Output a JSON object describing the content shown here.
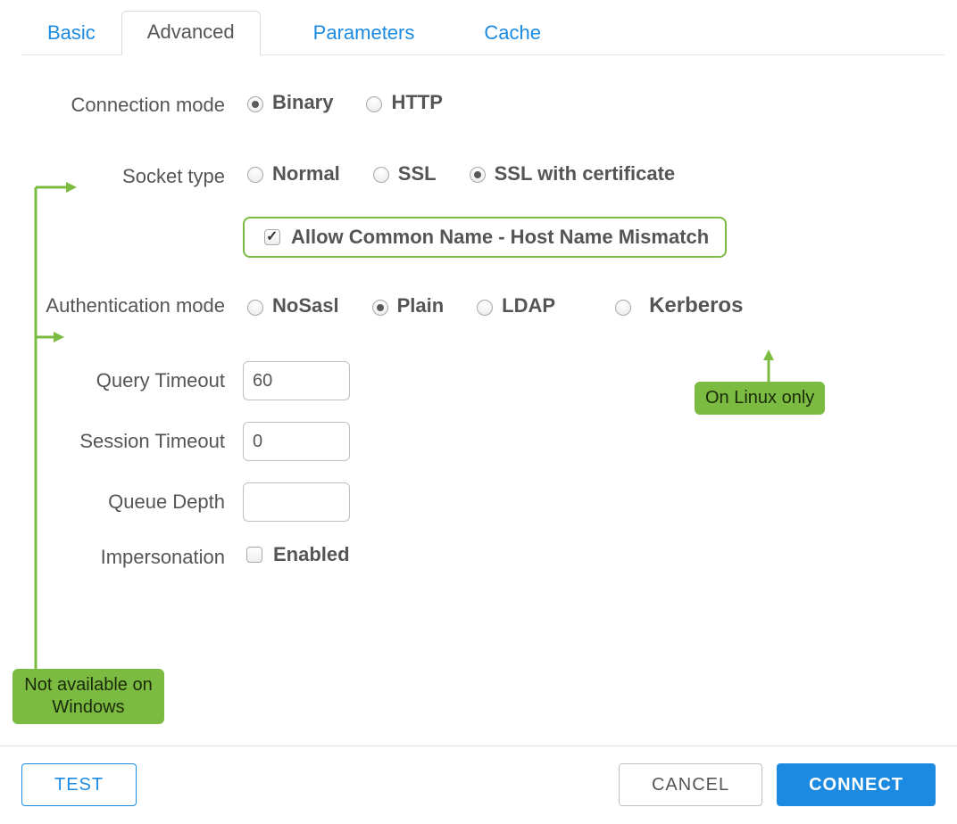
{
  "tabs": {
    "basic": "Basic",
    "advanced": "Advanced",
    "parameters": "Parameters",
    "cache": "Cache"
  },
  "labels": {
    "connection_mode": "Connection mode",
    "socket_type": "Socket type",
    "auth_mode": "Authentication mode",
    "query_timeout": "Query Timeout",
    "session_timeout": "Session Timeout",
    "queue_depth": "Queue Depth",
    "impersonation": "Impersonation"
  },
  "options": {
    "conn_binary": "Binary",
    "conn_http": "HTTP",
    "sock_normal": "Normal",
    "sock_ssl": "SSL",
    "sock_ssl_cert": "SSL with certificate",
    "allow_common_name": "Allow Common Name - Host Name Mismatch",
    "auth_nosasl": "NoSasl",
    "auth_plain": "Plain",
    "auth_ldap": "LDAP",
    "auth_kerberos": "Kerberos",
    "impersonation_enabled": "Enabled"
  },
  "values": {
    "query_timeout": "60",
    "session_timeout": "0",
    "queue_depth": ""
  },
  "annotations": {
    "not_windows": "Not available on Windows",
    "linux_only": "On Linux only"
  },
  "buttons": {
    "test": "TEST",
    "cancel": "CANCEL",
    "connect": "CONNECT"
  },
  "colors": {
    "accent_blue": "#1b8ae0",
    "callout_green": "#7cbb42"
  }
}
